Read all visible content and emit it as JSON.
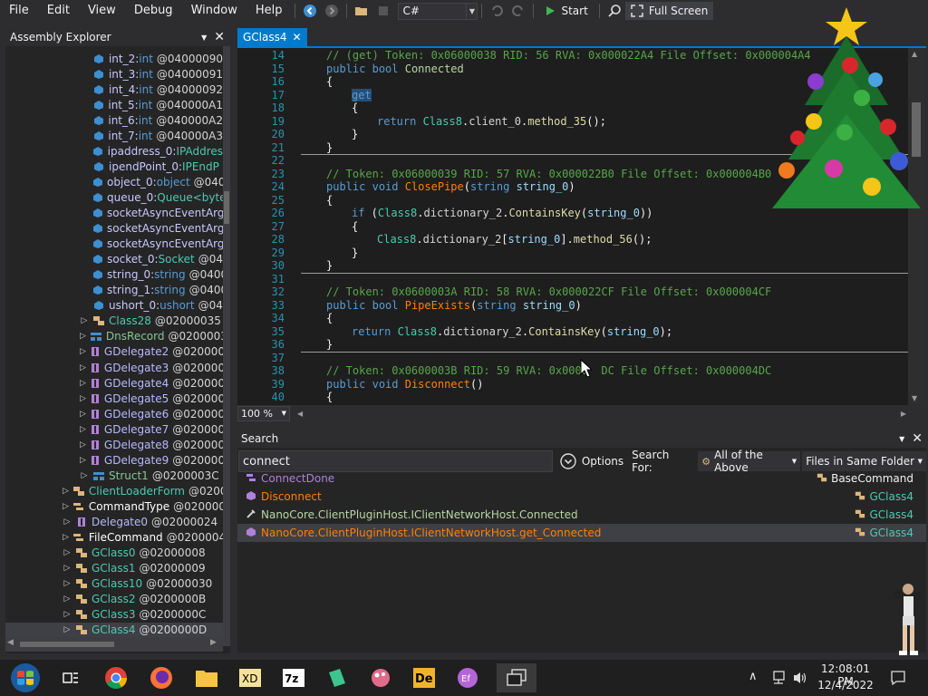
{
  "menu": [
    "File",
    "Edit",
    "View",
    "Debug",
    "Window",
    "Help"
  ],
  "toolbar": {
    "language": "C#",
    "start_label": "Start",
    "fullscreen_label": "Full Screen"
  },
  "assembly_explorer": {
    "title": "Assembly Explorer",
    "items": [
      {
        "name": "int_2",
        "type": "int",
        "token": "@04000090",
        "kind": "field"
      },
      {
        "name": "int_3",
        "type": "int",
        "token": "@04000091",
        "kind": "field"
      },
      {
        "name": "int_4",
        "type": "int",
        "token": "@04000092",
        "kind": "field"
      },
      {
        "name": "int_5",
        "type": "int",
        "token": "@040000A1",
        "kind": "field"
      },
      {
        "name": "int_6",
        "type": "int",
        "token": "@040000A2",
        "kind": "field"
      },
      {
        "name": "int_7",
        "type": "int",
        "token": "@040000A3",
        "kind": "field"
      },
      {
        "name": "ipaddress_0",
        "type": "IPAddres",
        "token": "",
        "kind": "field"
      },
      {
        "name": "ipendPoint_0",
        "type": "IPEndP",
        "token": "",
        "kind": "field"
      },
      {
        "name": "object_0",
        "type": "object",
        "token": "@040",
        "kind": "field"
      },
      {
        "name": "queue_0",
        "type": "Queue<byte",
        "token": "",
        "kind": "field"
      },
      {
        "name": "socketAsyncEventArgs",
        "type": "",
        "token": "",
        "kind": "field"
      },
      {
        "name": "socketAsyncEventArgs",
        "type": "",
        "token": "",
        "kind": "field"
      },
      {
        "name": "socketAsyncEventArgs",
        "type": "",
        "token": "",
        "kind": "field"
      },
      {
        "name": "socket_0",
        "type": "Socket",
        "token": "@04",
        "kind": "field"
      },
      {
        "name": "string_0",
        "type": "string",
        "token": "@0400",
        "kind": "field"
      },
      {
        "name": "string_1",
        "type": "string",
        "token": "@0400",
        "kind": "field"
      },
      {
        "name": "ushort_0",
        "type": "ushort",
        "token": "@04",
        "kind": "field"
      },
      {
        "name": "Class28",
        "type": "",
        "token": "@02000035",
        "kind": "class"
      },
      {
        "name": "DnsRecord",
        "type": "",
        "token": "@0200003E",
        "kind": "struct"
      },
      {
        "name": "GDelegate2",
        "type": "",
        "token": "@0200003",
        "kind": "delegate"
      },
      {
        "name": "GDelegate3",
        "type": "",
        "token": "@0200003",
        "kind": "delegate"
      },
      {
        "name": "GDelegate4",
        "type": "",
        "token": "@0200003",
        "kind": "delegate"
      },
      {
        "name": "GDelegate5",
        "type": "",
        "token": "@0200003",
        "kind": "delegate"
      },
      {
        "name": "GDelegate6",
        "type": "",
        "token": "@0200003",
        "kind": "delegate"
      },
      {
        "name": "GDelegate7",
        "type": "",
        "token": "@0200003",
        "kind": "delegate"
      },
      {
        "name": "GDelegate8",
        "type": "",
        "token": "@0200003",
        "kind": "delegate"
      },
      {
        "name": "GDelegate9",
        "type": "",
        "token": "@0200003",
        "kind": "delegate"
      },
      {
        "name": "Struct1",
        "type": "",
        "token": "@0200003C",
        "kind": "struct"
      },
      {
        "name": "ClientLoaderForm",
        "type": "",
        "token": "@0200",
        "kind": "class"
      },
      {
        "name": "CommandType",
        "type": "",
        "token": "@0200003",
        "kind": "enum"
      },
      {
        "name": "Delegate0",
        "type": "",
        "token": "@02000024",
        "kind": "delegate"
      },
      {
        "name": "FileCommand",
        "type": "",
        "token": "@0200004C",
        "kind": "enum"
      },
      {
        "name": "GClass0",
        "type": "",
        "token": "@02000008",
        "kind": "class"
      },
      {
        "name": "GClass1",
        "type": "",
        "token": "@02000009",
        "kind": "class"
      },
      {
        "name": "GClass10",
        "type": "",
        "token": "@02000030",
        "kind": "class"
      },
      {
        "name": "GClass2",
        "type": "",
        "token": "@0200000B",
        "kind": "class"
      },
      {
        "name": "GClass3",
        "type": "",
        "token": "@0200000C",
        "kind": "class"
      },
      {
        "name": "GClass4",
        "type": "",
        "token": "@0200000D",
        "kind": "class"
      }
    ]
  },
  "editor": {
    "tab_label": "GClass4",
    "zoom": "100 %",
    "line_numbers": [
      "14",
      "15",
      "16",
      "17",
      "18",
      "19",
      "20",
      "21",
      "22",
      "23",
      "24",
      "25",
      "26",
      "27",
      "28",
      "29",
      "30",
      "31",
      "32",
      "33",
      "34",
      "35",
      "36",
      "37",
      "38",
      "39",
      "40"
    ],
    "comments": {
      "c14": "// (get) Token: 0x06000038 RID: 56 RVA: 0x000022A4 File Offset: 0x000004A4",
      "c23": "// Token: 0x06000039 RID: 57 RVA: 0x000022B0 File Offset: 0x000004B0",
      "c32": "// Token: 0x0600003A RID: 58 RVA: 0x000022CF File Offset: 0x000004CF",
      "c38": "// Token: 0x0600003B RID: 59 RVA: 0x0000  DC File Offset: 0x000004DC"
    },
    "tokens": {
      "kw_public": "public",
      "kw_bool": "bool",
      "kw_void": "void",
      "kw_string": "string",
      "kw_get": "get",
      "kw_return": "return",
      "kw_if": "if",
      "ty_class8": "Class8",
      "prop_connected": "Connected",
      "m_closepipe": "ClosePipe",
      "m_pipeexists": "PipeExists",
      "m_disconnect": "Disconnect",
      "m_method35": "method_35",
      "m_containskey": "ContainsKey",
      "m_method56": "method_56",
      "f_client0": "client_0",
      "f_dict2": "dictionary_2",
      "p_string0": "string_0"
    }
  },
  "search": {
    "title": "Search",
    "query": "connect",
    "options_label": "Options",
    "search_for_label": "Search For:",
    "search_for_value": "All of the Above",
    "scope_value": "Files in Same Folder",
    "results": [
      {
        "name": "ConnectDone",
        "owner": "BaseCommand",
        "kind": "enum"
      },
      {
        "name": "Disconnect",
        "owner": "GClass4",
        "kind": "method"
      },
      {
        "name": "NanoCore.ClientPluginHost.IClientNetworkHost.Connected",
        "owner": "GClass4",
        "kind": "property"
      },
      {
        "name": "NanoCore.ClientPluginHost.IClientNetworkHost.get_Connected",
        "owner": "GClass4",
        "kind": "method"
      }
    ]
  },
  "taskbar": {
    "time": "12:08:01 PM",
    "date": "12/4/2022"
  },
  "colors": {
    "accent": "#007acc",
    "background": "#2d2d30",
    "editor_bg": "#1e1e1e"
  }
}
